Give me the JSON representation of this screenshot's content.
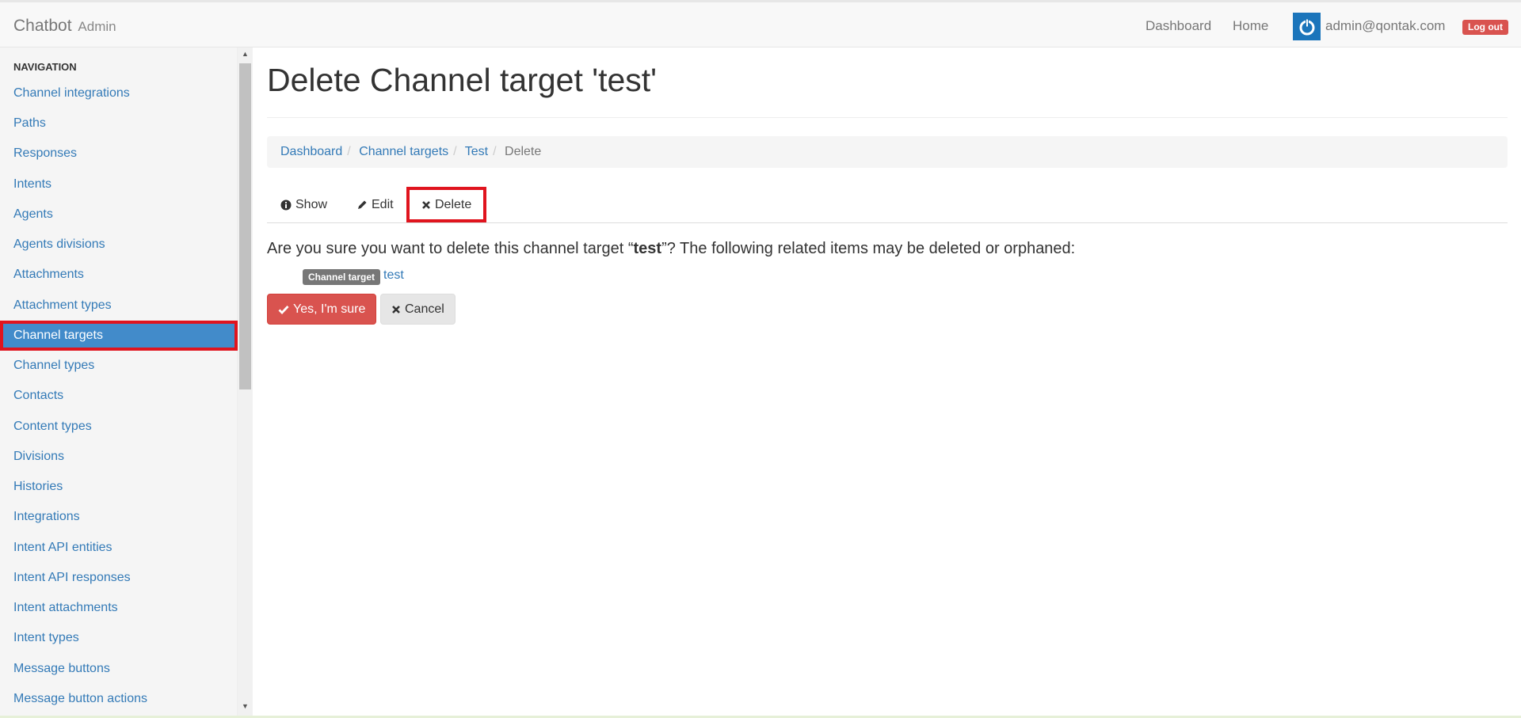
{
  "navbar": {
    "brand": "Chatbot",
    "brand_sub": "Admin",
    "links": [
      "Dashboard",
      "Home"
    ],
    "user_email": "admin@qontak.com",
    "logout_label": "Log out"
  },
  "sidebar": {
    "header": "NAVIGATION",
    "items": [
      {
        "label": "Channel integrations"
      },
      {
        "label": "Paths"
      },
      {
        "label": "Responses"
      },
      {
        "label": "Intents"
      },
      {
        "label": "Agents"
      },
      {
        "label": "Agents divisions"
      },
      {
        "label": "Attachments"
      },
      {
        "label": "Attachment types"
      },
      {
        "label": "Channel targets",
        "active": true
      },
      {
        "label": "Channel types"
      },
      {
        "label": "Contacts"
      },
      {
        "label": "Content types"
      },
      {
        "label": "Divisions"
      },
      {
        "label": "Histories"
      },
      {
        "label": "Integrations"
      },
      {
        "label": "Intent API entities"
      },
      {
        "label": "Intent API responses"
      },
      {
        "label": "Intent attachments"
      },
      {
        "label": "Intent types"
      },
      {
        "label": "Message buttons"
      },
      {
        "label": "Message button actions"
      }
    ]
  },
  "main": {
    "title": "Delete Channel target 'test'",
    "breadcrumb": [
      "Dashboard",
      "Channel targets",
      "Test"
    ],
    "breadcrumb_current": "Delete",
    "tabs": [
      {
        "label": "Show",
        "icon": "info-circle-icon"
      },
      {
        "label": "Edit",
        "icon": "pencil-icon"
      },
      {
        "label": "Delete",
        "icon": "times-icon"
      }
    ],
    "confirm_prefix": "Are you sure you want to delete this channel target “",
    "confirm_object": "test",
    "confirm_suffix": "”? The following related items may be deleted or orphaned:",
    "related_label": "Channel target",
    "related_link": "test",
    "confirm_button": "Yes, I'm sure",
    "cancel_button": "Cancel"
  },
  "colors": {
    "link": "#337ab7",
    "active_bg": "#428bca",
    "highlight_border": "#e0141e",
    "danger": "#d9534f"
  }
}
